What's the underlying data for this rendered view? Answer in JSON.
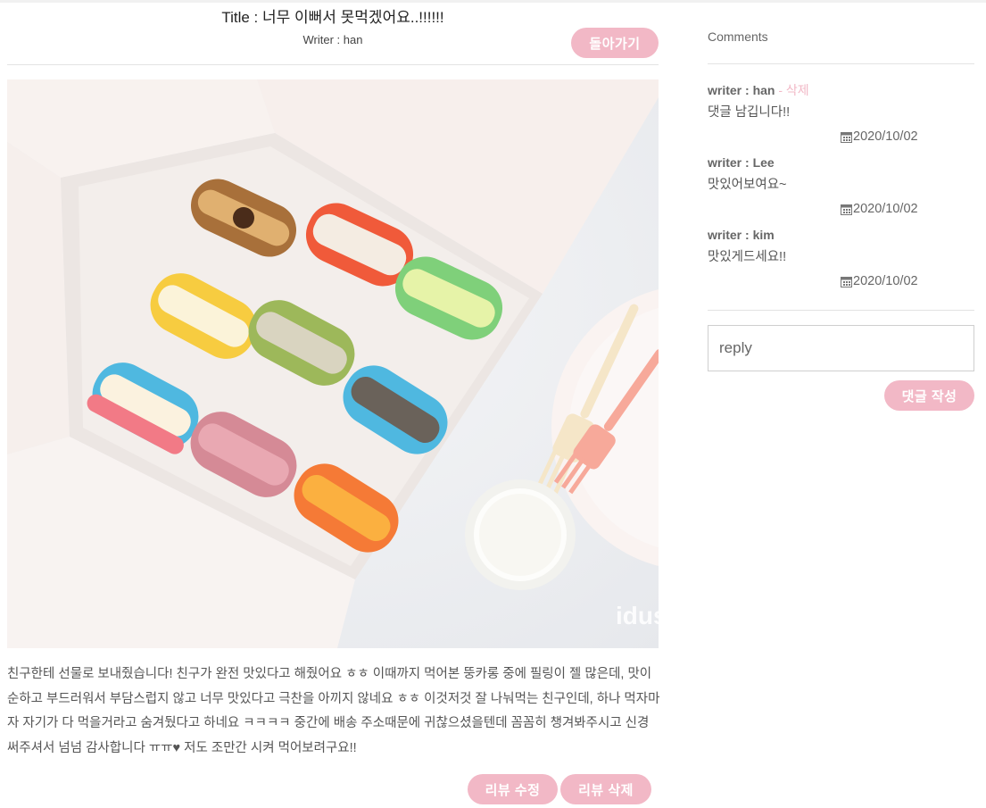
{
  "post": {
    "title_prefix": "Title : ",
    "title": "너무 이뻐서 못먹겠어요..!!!!!!",
    "writer_line": "Writer : han",
    "back_label": "돌아가기",
    "body": "친구한테 선물로 보내줬습니다! 친구가 완전 맛있다고 해줬어요 ㅎㅎ 이때까지 먹어본 뚱카롱 중에 필링이 젤 많은데, 맛이 순하고 부드러워서 부담스럽지 않고 너무 맛있다고 극찬을 아끼지 않네요 ㅎㅎ 이것저것 잘 나눠먹는 친구인데, 하나 먹자마자 자기가 다 먹을거라고 숨겨뒀다고 하네요 ㅋㅋㅋㅋ 중간에 배송 주소때문에 귀찮으셨을텐데 꼼꼼히 챙겨봐주시고 신경써주셔서 넘넘 감사합니다 ㅠㅠ♥ 저도 조만간 시켜 먹어보려구요!!",
    "edit_label": "리뷰 수정",
    "delete_label": "리뷰 삭제",
    "watermark": "idus"
  },
  "comments_panel": {
    "heading": "Comments",
    "delete_label": "삭제",
    "items": [
      {
        "writer": "writer : han",
        "text": "댓글 남깁니다!!",
        "date": "2020/10/02",
        "deletable": true
      },
      {
        "writer": "writer : Lee",
        "text": "맛있어보여요~",
        "date": "2020/10/02",
        "deletable": false
      },
      {
        "writer": "writer : kim",
        "text": "맛있게드세요!!",
        "date": "2020/10/02",
        "deletable": false
      }
    ],
    "reply_placeholder": "reply",
    "reply_button": "댓글 작성"
  },
  "icons": {
    "date": "calendar-icon"
  },
  "colors": {
    "accent": "#f2b8c6",
    "divider": "#e3e3e3"
  }
}
